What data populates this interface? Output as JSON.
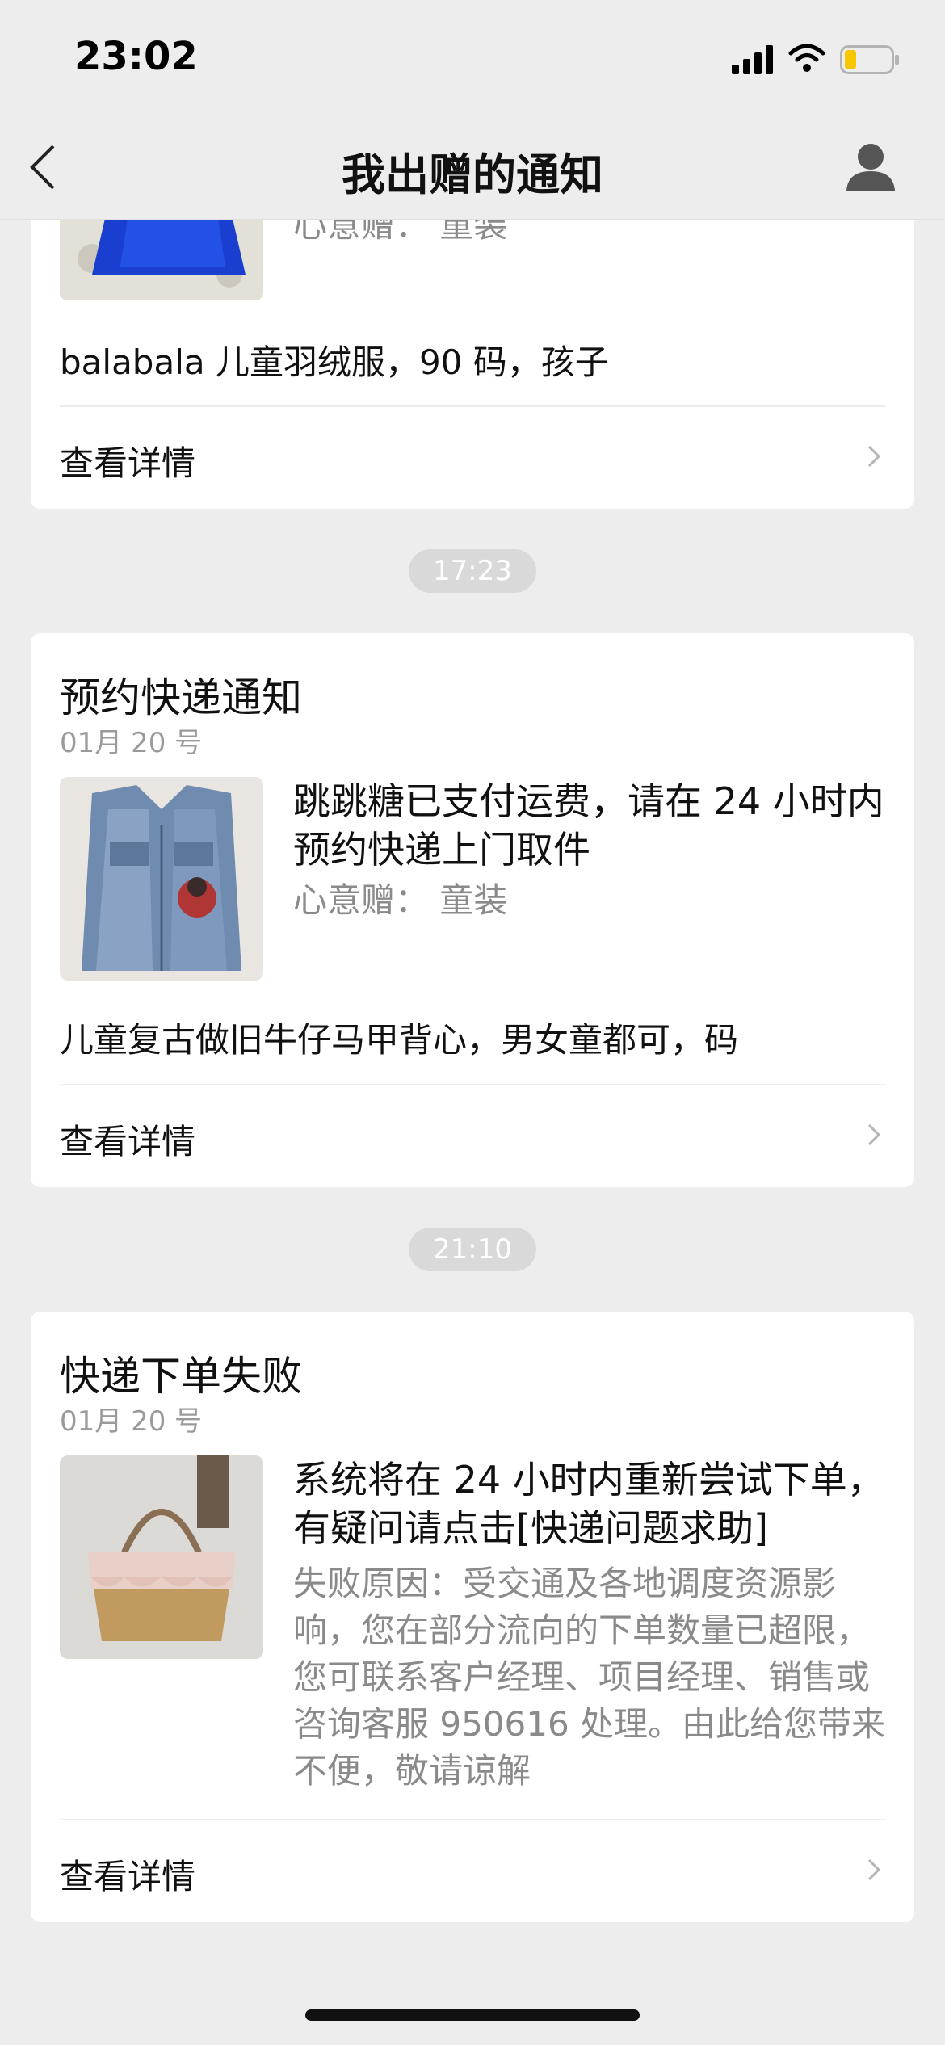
{
  "status_bar": {
    "time": "23:02"
  },
  "nav": {
    "title": "我出赠的通知"
  },
  "cards": [
    {
      "partial_sub": "心意赠： 童装",
      "description": "balabala 儿童羽绒服，90 码，孩子",
      "detail_label": "查看详情"
    },
    {
      "timestamp": "17:23",
      "title": "预约快递通知",
      "date": "01月 20 号",
      "message": "跳跳糖已支付运费，请在 24 小时内预约快递上门取件",
      "sub": "心意赠： 童装",
      "description": "儿童复古做旧牛仔马甲背心，男女童都可，码",
      "detail_label": "查看详情"
    },
    {
      "timestamp": "21:10",
      "title": "快递下单失败",
      "date": "01月 20 号",
      "message": "系统将在 24 小时内重新尝试下单，有疑问请点击[快递问题求助]",
      "sub": "失败原因：受交通及各地调度资源影响，您在部分流向的下单数量已超限，您可联系客户经理、项目经理、销售或咨询客服 950616 处理。由此给您带来不便，敬请谅解",
      "detail_label": "查看详情"
    }
  ],
  "icons": {
    "back": "chevron-left-icon",
    "profile": "user-profile-icon",
    "signal": "cellular-signal-icon",
    "wifi": "wifi-icon",
    "battery": "battery-low-icon",
    "chevron": "chevron-right-icon"
  },
  "colors": {
    "background": "#ededed",
    "card": "#ffffff",
    "muted": "#8a8a8a",
    "battery_low": "#f7c600"
  }
}
